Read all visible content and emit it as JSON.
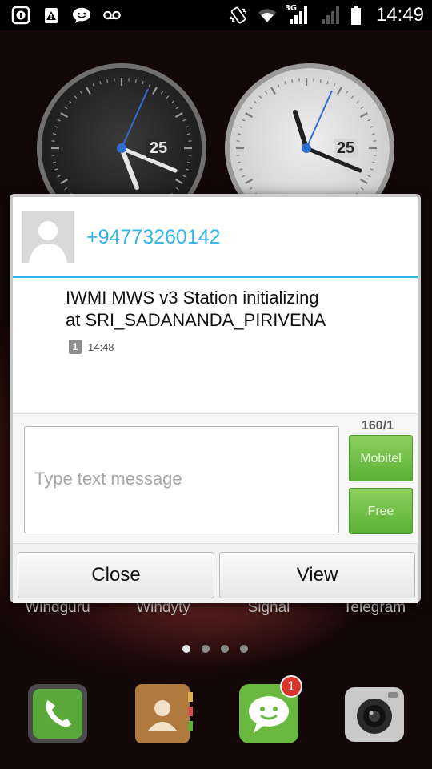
{
  "status_bar": {
    "time": "14:49",
    "network_label": "3G",
    "icons_left": [
      "info-icon",
      "alert-icon",
      "chat-icon",
      "voicemail-icon"
    ],
    "icons_right": [
      "vibrate-icon",
      "wifi-icon",
      "signal-icon",
      "signal-icon",
      "battery-icon"
    ]
  },
  "clock_widgets": [
    {
      "style": "dark",
      "date": "25"
    },
    {
      "style": "light",
      "date": "25"
    }
  ],
  "dialog": {
    "sender": "+94773260142",
    "message_line1": "IWMI MWS v3 Station initializing",
    "message_line2": "at SRI_SADANANDA_PIRIVENA",
    "sim_number": "1",
    "message_time": "14:48",
    "compose": {
      "placeholder": "Type text message",
      "value": "",
      "counter": "160/1",
      "sim1_label": "Mobitel",
      "sim2_label": "Free"
    },
    "close_label": "Close",
    "view_label": "View"
  },
  "home_apps": [
    "Windguru",
    "Windyty",
    "Signal",
    "Telegram"
  ],
  "page_indicator": {
    "count": 4,
    "active": 1
  },
  "dock": {
    "apps": [
      "phone-icon",
      "contacts-icon",
      "messaging-icon",
      "camera-icon"
    ],
    "messaging_badge": "1"
  },
  "colors": {
    "accent": "#33b5e5",
    "sim_button": "#6cbf3d",
    "badge": "#d9342c"
  }
}
